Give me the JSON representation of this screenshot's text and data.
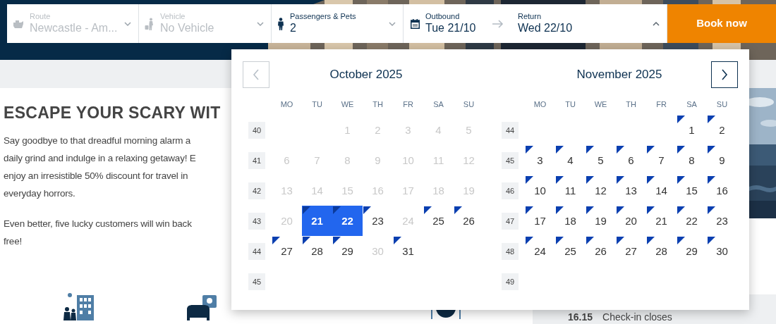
{
  "booking_bar": {
    "fields": [
      {
        "kind": "route",
        "label": "Route",
        "value": "Newcastle - Am...",
        "disabled": true,
        "expanded": false
      },
      {
        "kind": "vehicle",
        "label": "Vehicle",
        "value": "No Vehicle",
        "disabled": true,
        "expanded": false
      },
      {
        "kind": "passengers",
        "label": "Passengers & Pets",
        "value": "2",
        "disabled": false,
        "expanded": false
      }
    ],
    "dates": {
      "outbound_label": "Outbound",
      "outbound": "Tue 21/10",
      "return_label": "Return",
      "return": "Wed 22/10",
      "expanded": true
    },
    "book_button": "Book now"
  },
  "article": {
    "heading": "ESCAPE YOUR SCARY WIT",
    "paragraphs": [
      [
        "Say goodbye to that dreadful morning alarm a",
        "daily grind and indulge in a relaxing getaway! E",
        "enjoy an irresistible 50% discount for travel in",
        "everyday horrors."
      ],
      [
        "Even better, five lucky customers will win back",
        "free!"
      ]
    ]
  },
  "check_in": {
    "time": "16.15",
    "label": "Check-in closes"
  },
  "calendar": {
    "prev": {
      "disabled": true
    },
    "next": {
      "disabled": false
    },
    "months": [
      {
        "title": "October 2025",
        "weekdays": [
          "MO",
          "TU",
          "WE",
          "TH",
          "FR",
          "SA",
          "SU"
        ],
        "weeks": [
          {
            "number": "40",
            "days": [
              {
                "kind": "blank"
              },
              {
                "kind": "blank"
              },
              {
                "kind": "day",
                "day": "1",
                "disabled": true,
                "available": false,
                "selected": false
              },
              {
                "kind": "day",
                "day": "2",
                "disabled": true,
                "available": false,
                "selected": false
              },
              {
                "kind": "day",
                "day": "3",
                "disabled": true,
                "available": false,
                "selected": false
              },
              {
                "kind": "day",
                "day": "4",
                "disabled": true,
                "available": false,
                "selected": false
              },
              {
                "kind": "day",
                "day": "5",
                "disabled": true,
                "available": false,
                "selected": false
              }
            ]
          },
          {
            "number": "41",
            "days": [
              {
                "kind": "day",
                "day": "6",
                "disabled": true,
                "available": false,
                "selected": false
              },
              {
                "kind": "day",
                "day": "7",
                "disabled": true,
                "available": false,
                "selected": false
              },
              {
                "kind": "day",
                "day": "8",
                "disabled": true,
                "available": false,
                "selected": false
              },
              {
                "kind": "day",
                "day": "9",
                "disabled": true,
                "available": false,
                "selected": false
              },
              {
                "kind": "day",
                "day": "10",
                "disabled": true,
                "available": false,
                "selected": false
              },
              {
                "kind": "day",
                "day": "11",
                "disabled": true,
                "available": false,
                "selected": false
              },
              {
                "kind": "day",
                "day": "12",
                "disabled": true,
                "available": false,
                "selected": false
              }
            ]
          },
          {
            "number": "42",
            "days": [
              {
                "kind": "day",
                "day": "13",
                "disabled": true,
                "available": false,
                "selected": false
              },
              {
                "kind": "day",
                "day": "14",
                "disabled": true,
                "available": false,
                "selected": false
              },
              {
                "kind": "day",
                "day": "15",
                "disabled": true,
                "available": false,
                "selected": false
              },
              {
                "kind": "day",
                "day": "16",
                "disabled": true,
                "available": false,
                "selected": false
              },
              {
                "kind": "day",
                "day": "17",
                "disabled": true,
                "available": false,
                "selected": false
              },
              {
                "kind": "day",
                "day": "18",
                "disabled": true,
                "available": false,
                "selected": false
              },
              {
                "kind": "day",
                "day": "19",
                "disabled": true,
                "available": false,
                "selected": false
              }
            ]
          },
          {
            "number": "43",
            "days": [
              {
                "kind": "day",
                "day": "20",
                "disabled": true,
                "available": false,
                "selected": false
              },
              {
                "kind": "day",
                "day": "21",
                "disabled": false,
                "available": true,
                "selected": true
              },
              {
                "kind": "day",
                "day": "22",
                "disabled": false,
                "available": true,
                "selected": true
              },
              {
                "kind": "day",
                "day": "23",
                "disabled": false,
                "available": true,
                "selected": false
              },
              {
                "kind": "day",
                "day": "24",
                "disabled": true,
                "available": false,
                "selected": false
              },
              {
                "kind": "day",
                "day": "25",
                "disabled": false,
                "available": true,
                "selected": false
              },
              {
                "kind": "day",
                "day": "26",
                "disabled": false,
                "available": true,
                "selected": false
              }
            ]
          },
          {
            "number": "44",
            "days": [
              {
                "kind": "day",
                "day": "27",
                "disabled": false,
                "available": true,
                "selected": false
              },
              {
                "kind": "day",
                "day": "28",
                "disabled": false,
                "available": true,
                "selected": false
              },
              {
                "kind": "day",
                "day": "29",
                "disabled": false,
                "available": true,
                "selected": false
              },
              {
                "kind": "day",
                "day": "30",
                "disabled": true,
                "available": false,
                "selected": false
              },
              {
                "kind": "day",
                "day": "31",
                "disabled": false,
                "available": true,
                "selected": false
              }
            ]
          },
          {
            "number": "45"
          }
        ]
      },
      {
        "title": "November 2025",
        "weekdays": [
          "MO",
          "TU",
          "WE",
          "TH",
          "FR",
          "SA",
          "SU"
        ],
        "weeks": [
          {
            "number": "44",
            "days": [
              {
                "kind": "blank"
              },
              {
                "kind": "blank"
              },
              {
                "kind": "blank"
              },
              {
                "kind": "blank"
              },
              {
                "kind": "blank"
              },
              {
                "kind": "day",
                "day": "1",
                "disabled": false,
                "available": true,
                "selected": false
              },
              {
                "kind": "day",
                "day": "2",
                "disabled": false,
                "available": true,
                "selected": false
              }
            ]
          },
          {
            "number": "45",
            "days": [
              {
                "kind": "day",
                "day": "3",
                "disabled": false,
                "available": true,
                "selected": false
              },
              {
                "kind": "day",
                "day": "4",
                "disabled": false,
                "available": true,
                "selected": false
              },
              {
                "kind": "day",
                "day": "5",
                "disabled": false,
                "available": true,
                "selected": false
              },
              {
                "kind": "day",
                "day": "6",
                "disabled": false,
                "available": true,
                "selected": false
              },
              {
                "kind": "day",
                "day": "7",
                "disabled": false,
                "available": true,
                "selected": false
              },
              {
                "kind": "day",
                "day": "8",
                "disabled": false,
                "available": true,
                "selected": false
              },
              {
                "kind": "day",
                "day": "9",
                "disabled": false,
                "available": true,
                "selected": false
              }
            ]
          },
          {
            "number": "46",
            "days": [
              {
                "kind": "day",
                "day": "10",
                "disabled": false,
                "available": true,
                "selected": false
              },
              {
                "kind": "day",
                "day": "11",
                "disabled": false,
                "available": true,
                "selected": false
              },
              {
                "kind": "day",
                "day": "12",
                "disabled": false,
                "available": true,
                "selected": false
              },
              {
                "kind": "day",
                "day": "13",
                "disabled": false,
                "available": true,
                "selected": false
              },
              {
                "kind": "day",
                "day": "14",
                "disabled": false,
                "available": true,
                "selected": false
              },
              {
                "kind": "day",
                "day": "15",
                "disabled": false,
                "available": true,
                "selected": false
              },
              {
                "kind": "day",
                "day": "16",
                "disabled": false,
                "available": true,
                "selected": false
              }
            ]
          },
          {
            "number": "47",
            "days": [
              {
                "kind": "day",
                "day": "17",
                "disabled": false,
                "available": true,
                "selected": false
              },
              {
                "kind": "day",
                "day": "18",
                "disabled": false,
                "available": true,
                "selected": false
              },
              {
                "kind": "day",
                "day": "19",
                "disabled": false,
                "available": true,
                "selected": false
              },
              {
                "kind": "day",
                "day": "20",
                "disabled": false,
                "available": true,
                "selected": false
              },
              {
                "kind": "day",
                "day": "21",
                "disabled": false,
                "available": true,
                "selected": false
              },
              {
                "kind": "day",
                "day": "22",
                "disabled": false,
                "available": true,
                "selected": false
              },
              {
                "kind": "day",
                "day": "23",
                "disabled": false,
                "available": true,
                "selected": false
              }
            ]
          },
          {
            "number": "48",
            "days": [
              {
                "kind": "day",
                "day": "24",
                "disabled": false,
                "available": true,
                "selected": false
              },
              {
                "kind": "day",
                "day": "25",
                "disabled": false,
                "available": true,
                "selected": false
              },
              {
                "kind": "day",
                "day": "26",
                "disabled": false,
                "available": true,
                "selected": false
              },
              {
                "kind": "day",
                "day": "27",
                "disabled": false,
                "available": true,
                "selected": false
              },
              {
                "kind": "day",
                "day": "28",
                "disabled": false,
                "available": true,
                "selected": false
              },
              {
                "kind": "day",
                "day": "29",
                "disabled": false,
                "available": true,
                "selected": false
              },
              {
                "kind": "day",
                "day": "30",
                "disabled": false,
                "available": true,
                "selected": false
              }
            ]
          },
          {
            "number": "49"
          }
        ]
      }
    ]
  }
}
